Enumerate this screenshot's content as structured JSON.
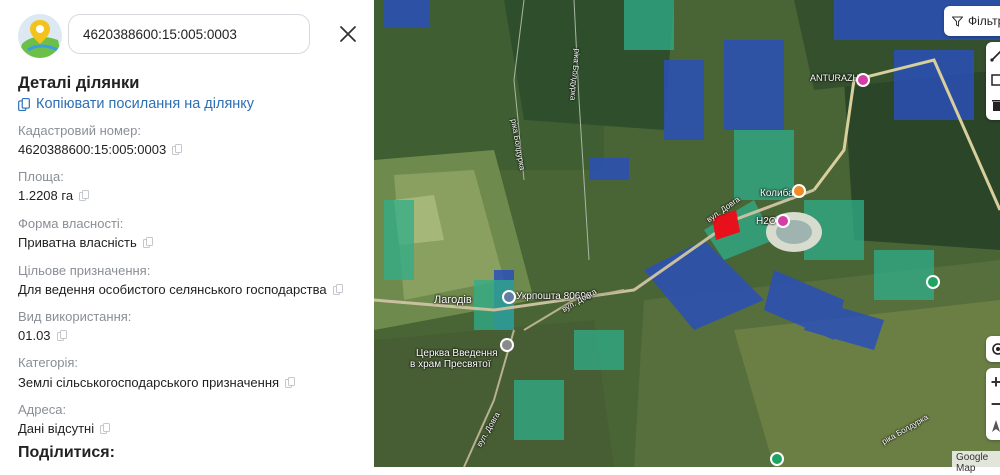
{
  "search": {
    "value": "4620388600:15:005:0003"
  },
  "details": {
    "title": "Деталі ділянки",
    "copy_link": "Копіювати посилання на ділянку",
    "fields": [
      {
        "label": "Кадастровий номер:",
        "value": "4620388600:15:005:0003"
      },
      {
        "label": "Площа:",
        "value": "1.2208 га"
      },
      {
        "label": "Форма власності:",
        "value": "Приватна власність"
      },
      {
        "label": "Цільове призначення:",
        "value": "Для ведення особистого селянського господарства"
      },
      {
        "label": "Вид використання:",
        "value": "01.03"
      },
      {
        "label": "Категорія:",
        "value": "Землі сільськогосподарського призначення"
      },
      {
        "label": "Адреса:",
        "value": "Дані відсутні"
      }
    ],
    "share_title": "Поділитися:"
  },
  "map": {
    "filter_label": "Фільтр",
    "attribution": "Google Map",
    "labels": {
      "village": "Лагодів",
      "post": "Укрпошта 80698",
      "church_1": "Церква Введення",
      "church_2": "в храм Пресвятої",
      "anturazh": "ANTURAZH",
      "h2o": "H2O",
      "kolyba": "Колиба",
      "river_1": "ріка Болдурка",
      "river_2": "ріка Болдурка",
      "river_3": "ріка Болдурка",
      "street_1": "вул. Довга",
      "street_2": "вул. Довга",
      "street_3": "вул. Довга"
    },
    "zoom_in": "+",
    "zoom_out": "−",
    "colors": {
      "parcel_highlight": "#e8101a",
      "parcel_blue": "#2a4fb8",
      "parcel_teal": "#2fae8a",
      "link": "#2c6fb5"
    }
  }
}
